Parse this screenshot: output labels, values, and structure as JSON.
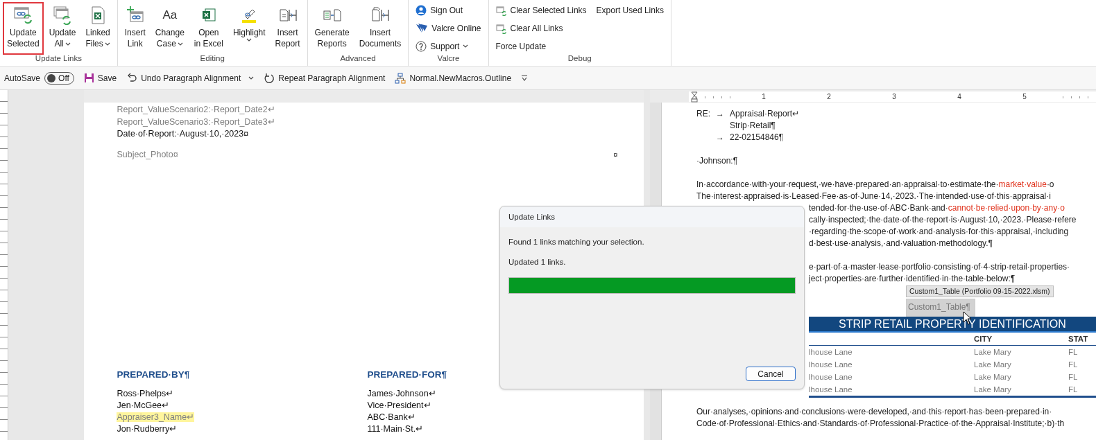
{
  "ribbon": {
    "groups": [
      {
        "label": "Update Links",
        "buttons": [
          {
            "lines": [
              "Update",
              "Selected"
            ],
            "dropdown": false,
            "highlighted": true
          },
          {
            "lines": [
              "Update",
              "All"
            ],
            "dropdown": true,
            "highlighted": false
          },
          {
            "lines": [
              "Linked",
              "Files"
            ],
            "dropdown": true,
            "highlighted": false
          }
        ]
      },
      {
        "label": "Editing",
        "buttons": [
          {
            "lines": [
              "Insert",
              "Link"
            ],
            "dropdown": false,
            "highlighted": false
          },
          {
            "glyph": "Aa",
            "lines": [
              "Change",
              "Case"
            ],
            "dropdown": true,
            "highlighted": false
          },
          {
            "lines": [
              "Open",
              "in Excel"
            ],
            "dropdown": false,
            "highlighted": false
          },
          {
            "lines": [
              "Highlight"
            ],
            "dropdown": true,
            "highlighted": false
          },
          {
            "lines": [
              "Insert",
              "Report"
            ],
            "dropdown": false,
            "highlighted": false
          }
        ]
      },
      {
        "label": "Advanced",
        "buttons": [
          {
            "lines": [
              "Generate",
              "Reports"
            ],
            "dropdown": false,
            "highlighted": false
          },
          {
            "lines": [
              "Insert",
              "Documents"
            ],
            "dropdown": false,
            "highlighted": false
          }
        ]
      },
      {
        "label": "Valcre",
        "columns": [
          [
            {
              "label": "Sign Out",
              "dropdown": false
            },
            {
              "label": "Valcre Online",
              "dropdown": false
            },
            {
              "label": "Support",
              "dropdown": true
            }
          ]
        ]
      },
      {
        "label": "Debug",
        "columns": [
          [
            {
              "label": "Clear Selected Links",
              "dropdown": false
            },
            {
              "label": "Clear All Links",
              "dropdown": false
            },
            {
              "label": "Force Update",
              "dropdown": false
            }
          ],
          [
            {
              "label": "Export Used Links",
              "dropdown": false
            }
          ]
        ]
      }
    ]
  },
  "quick_access": {
    "autosave": {
      "label": "AutoSave",
      "state": "Off",
      "on": false
    },
    "items": [
      {
        "label": "Save",
        "dropdown": false
      },
      {
        "label": "Undo Paragraph Alignment",
        "dropdown": true
      },
      {
        "label": "Repeat Paragraph Alignment",
        "dropdown": false
      },
      {
        "label": "Normal.NewMacros.Outline",
        "dropdown": false
      }
    ]
  },
  "left_page": {
    "lines": [
      {
        "text": "Report_ValueScenario2:·Report_Date2↵",
        "merge_field": true
      },
      {
        "text": "Report_ValueScenario3:·Report_Date3↵",
        "merge_field": true
      },
      {
        "text": "Date·of·Report:·August·10,·2023¤",
        "merge_field": false
      }
    ],
    "photo_row": {
      "text": "Subject_Photo¤",
      "end_mark": "¤",
      "merge_field": true
    },
    "prepared": [
      {
        "heading": "PREPARED·BY¶",
        "items": [
          {
            "text": "Ross·Phelps↵",
            "merge_field": false,
            "highlighted": false
          },
          {
            "text": "Jen·McGee↵",
            "merge_field": false,
            "highlighted": false
          },
          {
            "text": "Appraiser3_Name↵",
            "merge_field": true,
            "highlighted": true
          },
          {
            "text": "Jon·Rudberry↵",
            "merge_field": false,
            "highlighted": false
          }
        ]
      },
      {
        "heading": "PREPARED·FOR¶",
        "items": [
          {
            "text": "James·Johnson↵",
            "merge_field": false,
            "highlighted": false
          },
          {
            "text": "Vice·President↵",
            "merge_field": false,
            "highlighted": false
          },
          {
            "text": "ABC·Bank↵",
            "merge_field": false,
            "highlighted": false
          },
          {
            "text": "111·Main·St.↵",
            "merge_field": false,
            "highlighted": false
          }
        ]
      }
    ]
  },
  "right_page": {
    "ruler": [
      "1",
      "2",
      "3",
      "4",
      "5"
    ],
    "re_block": [
      {
        "label": "RE:",
        "arrow": "→",
        "text": "Appraisal·Report↵"
      },
      {
        "text": "Strip·Retail¶"
      },
      {
        "arrow": "→",
        "text": "22-02154846¶"
      }
    ],
    "salutation": "·Johnson:¶",
    "paragraphs": [
      [
        {
          "partial": false,
          "segments": [
            {
              "text": "In·accordance·with·your·request,·we·have·prepared·an·appraisal·to·estimate·the·",
              "emphasis": false
            },
            {
              "text": "market·value",
              "emphasis": true
            },
            {
              "text": "·o",
              "emphasis": false
            }
          ]
        },
        {
          "partial": false,
          "segments": [
            {
              "text": "The·interest·appraised·is·Leased·Fee·as·of·June·14,·2023.·The·intended·use·of·this·appraisal·i",
              "emphasis": false
            }
          ]
        },
        {
          "partial": true,
          "segments": [
            {
              "text": "tended·for·the·use·of·ABC·Bank·and·",
              "emphasis": false
            },
            {
              "text": "cannot·be·relied·upon·by·any·o",
              "emphasis": true
            }
          ]
        },
        {
          "partial": true,
          "segments": [
            {
              "text": "cally·inspected;·the·date·of·the·report·is·August·10,·2023.·Please·refere",
              "emphasis": false
            }
          ]
        },
        {
          "partial": true,
          "segments": [
            {
              "text": "·regarding·the·scope·of·work·and·analysis·for·this·appraisal,·including",
              "emphasis": false
            }
          ]
        },
        {
          "partial": true,
          "segments": [
            {
              "text": "d·best·use·analysis,·and·valuation·methodology.¶",
              "emphasis": false
            }
          ]
        }
      ],
      [
        {
          "partial": true,
          "segments": [
            {
              "text": "e·part·of·a·master·lease·portfolio·consisting·of·4·strip·retail·properties·",
              "emphasis": false
            }
          ]
        },
        {
          "partial": true,
          "segments": [
            {
              "text": "ject·properties·are·further·identified·in·the·table·below:¶",
              "emphasis": false
            }
          ]
        }
      ]
    ],
    "link_tooltip": "Custom1_Table (Portfolio 09-15-2022.xlsm)",
    "link_field": "Custom1_Table¶",
    "table": {
      "title": "STRIP RETAIL PROPERTY IDENTIFICATION",
      "columns": [
        "",
        "CITY",
        "STAT"
      ],
      "rows": [
        [
          "lhouse Lane",
          "Lake Mary",
          "FL"
        ],
        [
          "lhouse Lane",
          "Lake Mary",
          "FL"
        ],
        [
          "lhouse Lane",
          "Lake Mary",
          "FL"
        ],
        [
          "lhouse Lane",
          "Lake Mary",
          "FL"
        ]
      ]
    },
    "closing": [
      "Our·analyses,·opinions·and·conclusions·were·developed,·and·this·report·has·been·prepared·in·",
      "Code·of·Professional·Ethics·and·Standards·of·Professional·Practice·of·the·Appraisal·Institute;·b)·th"
    ]
  },
  "dialog": {
    "title": "Update Links",
    "messages": [
      "Found 1 links matching your selection.",
      "Updated 1 links."
    ],
    "progress": {
      "level": 1.0
    },
    "buttons": [
      "Cancel"
    ]
  }
}
